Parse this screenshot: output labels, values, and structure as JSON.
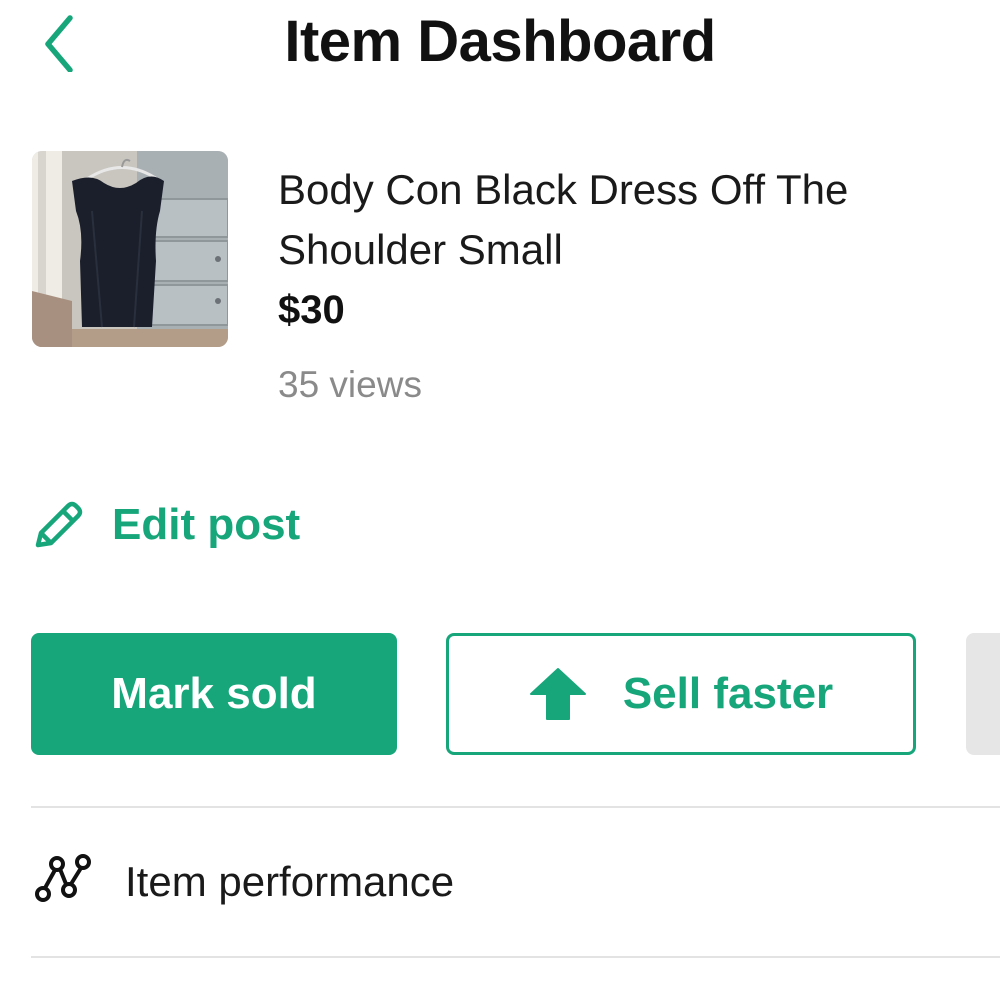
{
  "header": {
    "title": "Item Dashboard",
    "back_icon": "chevron-left-icon"
  },
  "item": {
    "title": "Body Con Black Dress Off The Shoulder Small",
    "price": "$30",
    "views": "35 views",
    "thumbnail_icon": "dress-photo"
  },
  "actions": {
    "edit_label": "Edit post",
    "edit_icon": "pencil-icon",
    "mark_sold_label": "Mark sold",
    "sell_faster_label": "Sell faster",
    "sell_faster_icon": "arrow-up-icon"
  },
  "rows": [
    {
      "label": "Item performance",
      "icon": "graph-nodes-icon"
    }
  ],
  "colors": {
    "accent": "#16a67a",
    "text": "#111111",
    "muted": "#8a8a8a",
    "divider": "#e3e3e3"
  }
}
